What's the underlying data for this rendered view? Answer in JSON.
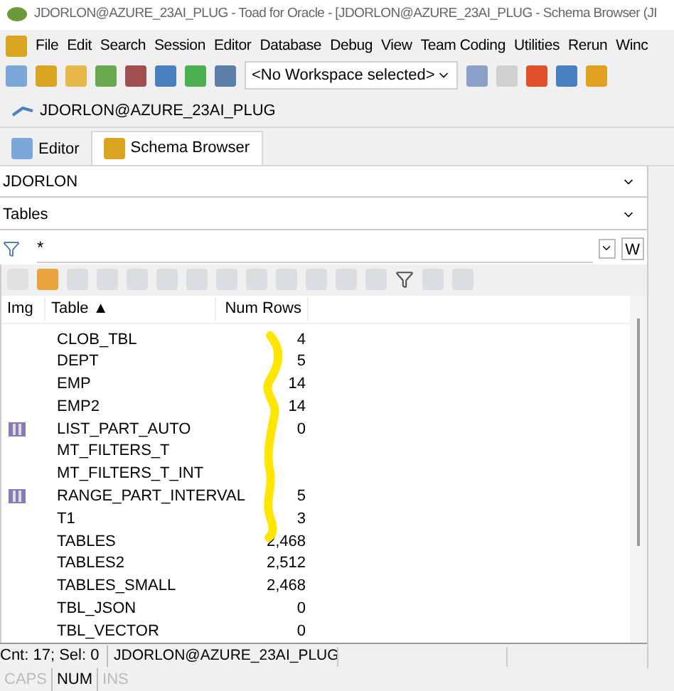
{
  "window": {
    "title": "JDORLON@AZURE_23AI_PLUG - Toad for Oracle - [JDORLON@AZURE_23AI_PLUG - Schema Browser (JI"
  },
  "menu": [
    "File",
    "Edit",
    "Search",
    "Session",
    "Editor",
    "Database",
    "Debug",
    "View",
    "Team Coding",
    "Utilities",
    "Rerun",
    "Winc"
  ],
  "toolbar": {
    "workspace": "<No Workspace selected>"
  },
  "connection_tab": "JDORLON@AZURE_23AI_PLUG",
  "tabs": [
    {
      "label": "Editor",
      "selected": false
    },
    {
      "label": "Schema Browser",
      "selected": true
    }
  ],
  "schema": "JDORLON",
  "object_type": "Tables",
  "filter": {
    "value": "*",
    "button": "W"
  },
  "table": {
    "columns": [
      "Img",
      "Table ▲",
      "Num Rows"
    ],
    "rows": [
      {
        "name": "CLOB_TBL",
        "rows": "4",
        "partitioned": false
      },
      {
        "name": "DEPT",
        "rows": "5",
        "partitioned": false
      },
      {
        "name": "EMP",
        "rows": "14",
        "partitioned": false
      },
      {
        "name": "EMP2",
        "rows": "14",
        "partitioned": false
      },
      {
        "name": "LIST_PART_AUTO",
        "rows": "0",
        "partitioned": true
      },
      {
        "name": "MT_FILTERS_T",
        "rows": "",
        "partitioned": false
      },
      {
        "name": "MT_FILTERS_T_INT",
        "rows": "",
        "partitioned": false
      },
      {
        "name": "RANGE_PART_INTERVAL",
        "rows": "5",
        "partitioned": true
      },
      {
        "name": "T1",
        "rows": "3",
        "partitioned": false
      },
      {
        "name": "TABLES",
        "rows": "2,468",
        "partitioned": false
      },
      {
        "name": "TABLES2",
        "rows": "2,512",
        "partitioned": false
      },
      {
        "name": "TABLES_SMALL",
        "rows": "2,468",
        "partitioned": false
      },
      {
        "name": "TBL_JSON",
        "rows": "0",
        "partitioned": false
      },
      {
        "name": "TBL_VECTOR",
        "rows": "0",
        "partitioned": false
      }
    ]
  },
  "status_bar": {
    "count": "Cnt: 17; Sel: 0",
    "connection": "JDORLON@AZURE_23AI_PLUG"
  },
  "indicators": [
    {
      "label": "CAPS",
      "on": false
    },
    {
      "label": "NUM",
      "on": true
    },
    {
      "label": "INS",
      "on": false
    }
  ]
}
